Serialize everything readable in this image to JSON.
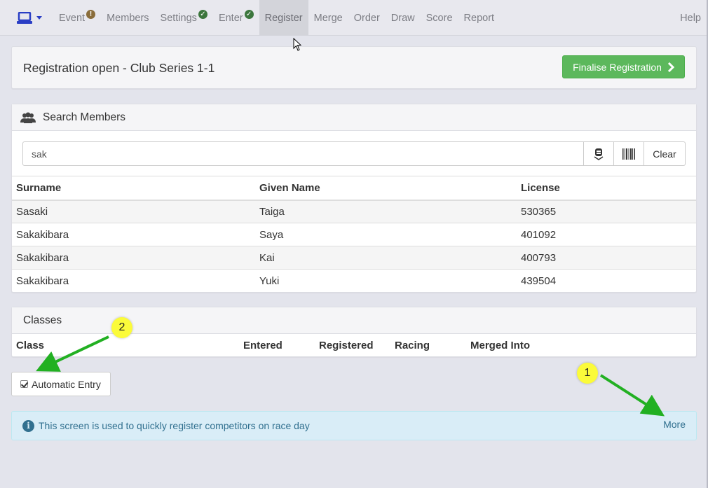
{
  "navbar": {
    "items": [
      {
        "label": "Event",
        "badge": "!",
        "badge_type": "warn",
        "active": false
      },
      {
        "label": "Members",
        "active": false
      },
      {
        "label": "Settings",
        "badge": "✓",
        "badge_type": "ok",
        "active": false
      },
      {
        "label": "Enter",
        "badge": "✓",
        "badge_type": "ok",
        "active": false
      },
      {
        "label": "Register",
        "active": true
      },
      {
        "label": "Merge",
        "active": false
      },
      {
        "label": "Order",
        "active": false
      },
      {
        "label": "Draw",
        "active": false
      },
      {
        "label": "Score",
        "active": false
      },
      {
        "label": "Report",
        "active": false
      }
    ],
    "help": "Help",
    "brand_icon": "laptop-icon"
  },
  "header": {
    "title": "Registration open - Club Series 1-1",
    "finalise_label": "Finalise Registration"
  },
  "search": {
    "heading": "Search Members",
    "value": "sak",
    "clear_label": "Clear",
    "columns": [
      "Surname",
      "Given Name",
      "License"
    ],
    "rows": [
      {
        "surname": "Sasaki",
        "given": "Taiga",
        "license": "530365"
      },
      {
        "surname": "Sakakibara",
        "given": "Saya",
        "license": "401092"
      },
      {
        "surname": "Sakakibara",
        "given": "Kai",
        "license": "400793"
      },
      {
        "surname": "Sakakibara",
        "given": "Yuki",
        "license": "439504"
      }
    ]
  },
  "classes": {
    "heading": "Classes",
    "columns": [
      "Class",
      "Entered",
      "Registered",
      "Racing",
      "Merged Into"
    ]
  },
  "auto_entry": {
    "label": "Automatic Entry",
    "checked": true
  },
  "info": {
    "text": "This screen is used to quickly register competitors on race day",
    "more_label": "More"
  },
  "annotations": {
    "marker_1": "1",
    "marker_2": "2",
    "arrow_color": "#22b022",
    "marker_color": "#fbfb3a"
  },
  "colors": {
    "primary_brand": "#2a3ec5",
    "success": "#5cb85c",
    "info_bg": "#d9edf7",
    "info_text": "#31708f"
  }
}
